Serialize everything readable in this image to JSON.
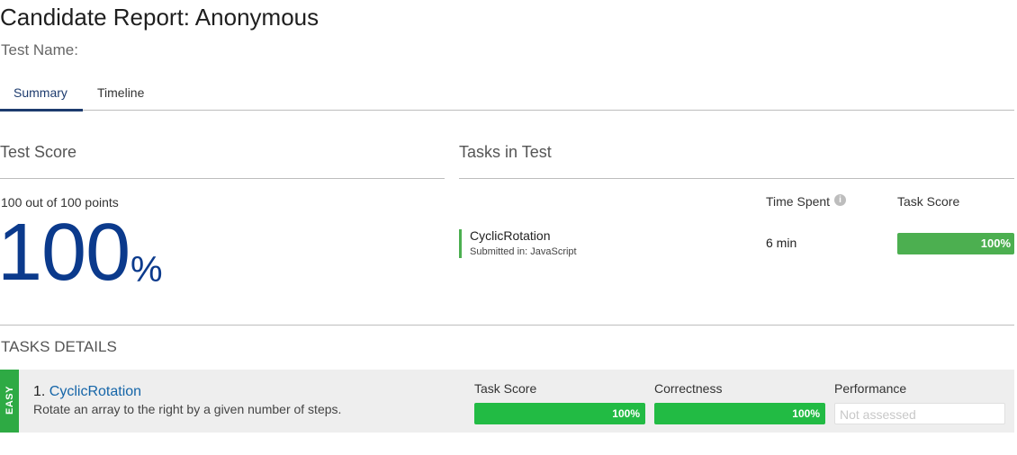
{
  "header": {
    "title": "Candidate Report: Anonymous",
    "test_name_label": "Test Name:"
  },
  "tabs": [
    {
      "label": "Summary",
      "active": true
    },
    {
      "label": "Timeline",
      "active": false
    }
  ],
  "test_score": {
    "heading": "Test Score",
    "points_text": "100 out of 100 points",
    "percent_value": "100",
    "percent_sign": "%"
  },
  "tasks_in_test": {
    "heading": "Tasks in Test",
    "columns": {
      "time_spent": "Time Spent",
      "task_score": "Task Score"
    },
    "info_icon": "info-icon",
    "tasks": [
      {
        "name": "CyclicRotation",
        "submitted": "Submitted in: JavaScript",
        "time": "6 min",
        "score": "100%",
        "score_fraction": 1.0
      }
    ]
  },
  "tasks_details": {
    "heading": "TASKS DETAILS",
    "items": [
      {
        "difficulty": "EASY",
        "number": "1.",
        "name": "CyclicRotation",
        "description": "Rotate an array to the right by a given number of steps.",
        "metrics": [
          {
            "label": "Task Score",
            "value": "100%",
            "fraction": 1.0
          },
          {
            "label": "Correctness",
            "value": "100%",
            "fraction": 1.0
          },
          {
            "label": "Performance",
            "value": "Not assessed",
            "fraction": null
          }
        ]
      }
    ]
  },
  "colors": {
    "primary": "#1d3b6e",
    "score_blue": "#0b3a8c",
    "success": "#4caf50",
    "easy": "#2eaa44",
    "link": "#1565a8"
  }
}
